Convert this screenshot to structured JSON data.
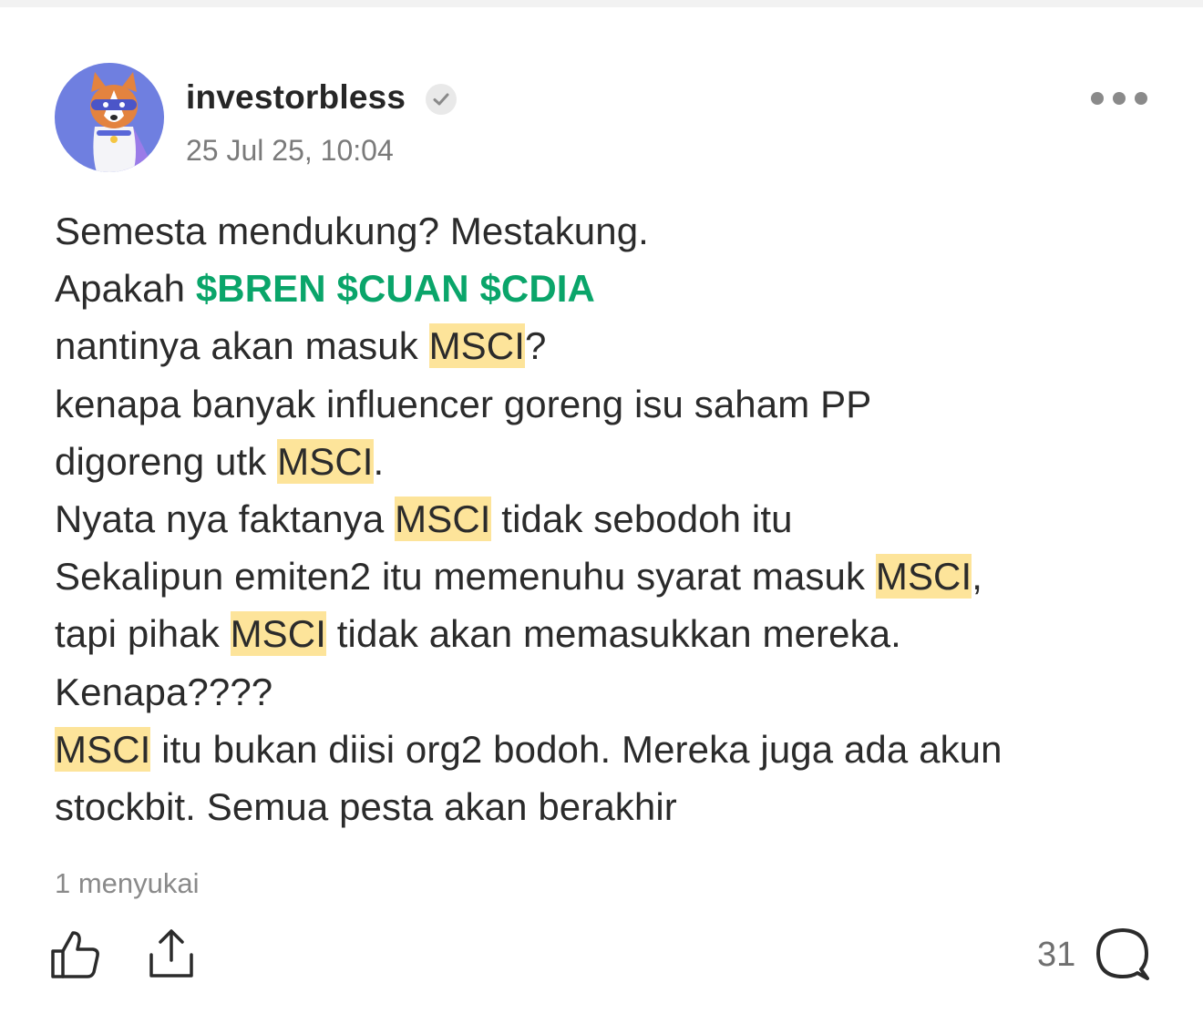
{
  "post": {
    "author": "investorbless",
    "verified_icon": "verified-check-icon",
    "timestamp": "25 Jul 25, 10:04",
    "colors": {
      "cashtag": "#0aa56a",
      "highlight": "#fde49a",
      "avatar_bg": "#6f7fe0"
    },
    "body": {
      "l1": "Semesta mendukung? Mestakung.",
      "l2_prefix": "Apakah ",
      "cashtags": [
        "$BREN",
        "$CUAN",
        "$CDIA"
      ],
      "l3_pre": "nantinya akan masuk ",
      "keyword": "MSCI",
      "l3_post": "?",
      "l4": "kenapa banyak influencer goreng isu saham PP",
      "l5_pre": "digoreng utk ",
      "l5_post": ".",
      "l6_pre": "Nyata nya faktanya ",
      "l6_post": " tidak sebodoh itu",
      "l7_pre": "Sekalipun emiten2 itu memenuhu syarat masuk ",
      "l7_post": ",",
      "l8_pre": "tapi pihak ",
      "l8_post": " tidak akan memasukkan mereka.",
      "l9": "Kenapa????",
      "l10_post": " itu bukan diisi org2 bodoh. Mereka juga ada akun",
      "l11": "stockbit. Semua pesta akan berakhir"
    },
    "likes_text": "1 menyukai",
    "comment_count": "31",
    "icons": {
      "more": "more-options-icon",
      "like": "thumbs-up-icon",
      "share": "share-icon",
      "comment": "comment-bubble-icon"
    }
  }
}
